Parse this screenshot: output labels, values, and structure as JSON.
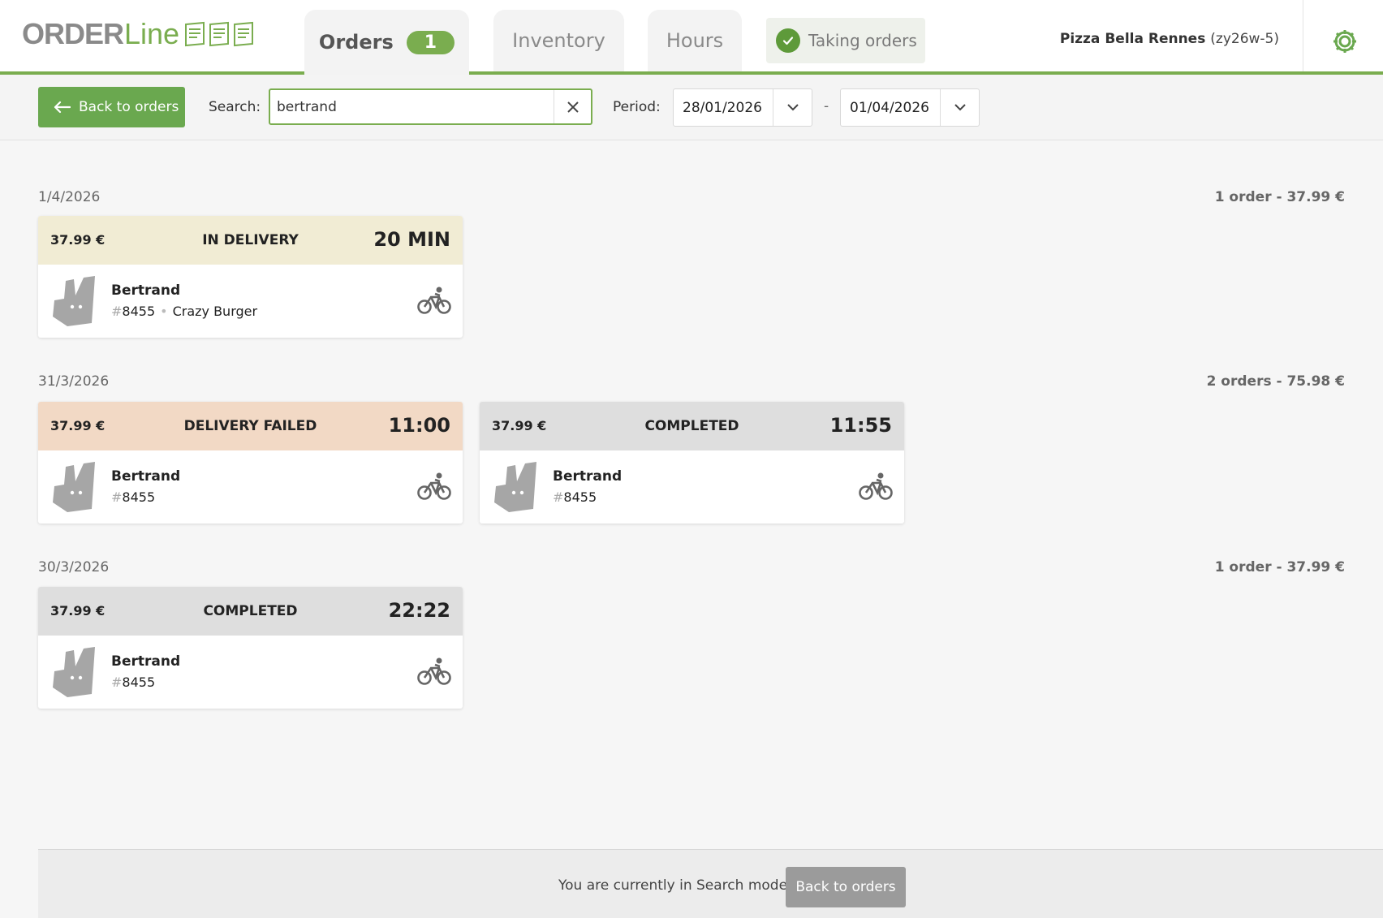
{
  "app": {
    "logo_order": "ORDER",
    "logo_line": "Line"
  },
  "tabs": [
    {
      "label": "Orders",
      "count": "1"
    },
    {
      "label": "Inventory"
    },
    {
      "label": "Hours"
    }
  ],
  "taking_orders": "Taking orders",
  "restaurant": {
    "name": "Pizza Bella Rennes",
    "code": "(zy26w-5)"
  },
  "toolbar": {
    "back_label": "Back to orders",
    "search_label": "Search:",
    "search_value": "bertrand",
    "period_label": "Period:",
    "date_from": "28/01/2026",
    "date_sep": "-",
    "date_to": "01/04/2026"
  },
  "groups": [
    {
      "date": "1/4/2026",
      "summary": "1 order - 37.99 €",
      "orders": [
        {
          "price": "37.99 €",
          "status": "IN DELIVERY",
          "time": "20 MIN",
          "customer": "Bertrand",
          "number": "8455",
          "brand": "Crazy Burger",
          "status_color": "#f1ecd4"
        }
      ]
    },
    {
      "date": "31/3/2026",
      "summary": "2 orders - 75.98 €",
      "orders": [
        {
          "price": "37.99 €",
          "status": "DELIVERY FAILED",
          "time": "11:00",
          "customer": "Bertrand",
          "number": "8455",
          "status_color": "#f2d9c5"
        },
        {
          "price": "37.99 €",
          "status": "COMPLETED",
          "time": "11:55",
          "customer": "Bertrand",
          "number": "8455",
          "status_color": "#dedede"
        }
      ]
    },
    {
      "date": "30/3/2026",
      "summary": "1 order - 37.99 €",
      "orders": [
        {
          "price": "37.99 €",
          "status": "COMPLETED",
          "time": "22:22",
          "customer": "Bertrand",
          "number": "8455",
          "status_color": "#dedede"
        }
      ]
    }
  ],
  "footer": {
    "message": "You are currently in Search mode.",
    "back_label": "Back to orders"
  },
  "colors": {
    "accent": "#7aad4f",
    "button_green": "#6aa84f",
    "button_grey": "#9b9b9b"
  },
  "icons": {
    "back": "arrow-left-icon",
    "clear": "close-icon",
    "dropdown": "chevron-down-icon",
    "settings": "gear-icon",
    "check": "check-icon",
    "platform": "deliveroo-bag-icon",
    "delivery": "bicycle-icon"
  }
}
